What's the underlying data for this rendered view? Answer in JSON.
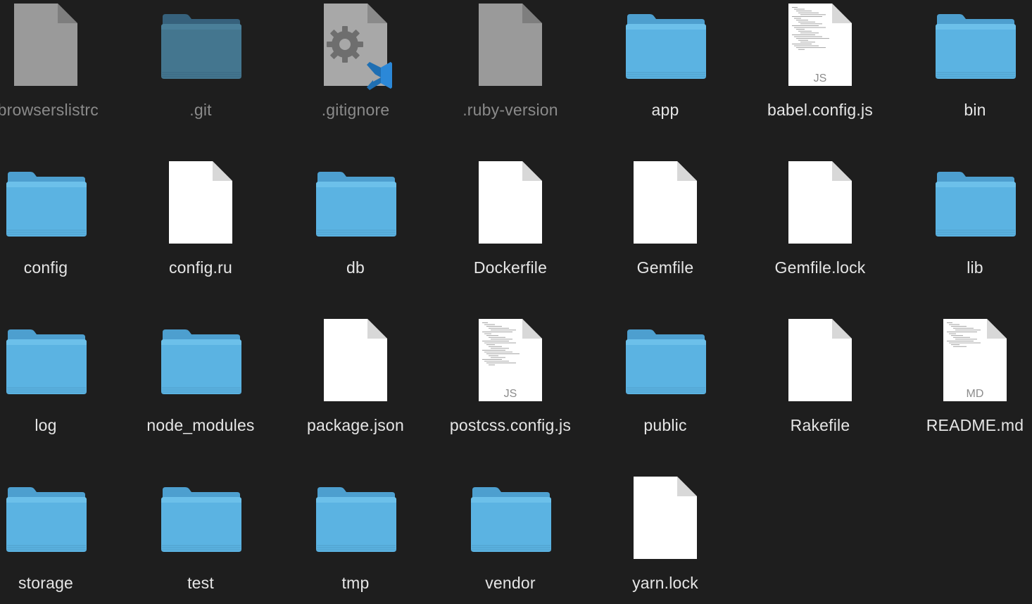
{
  "window": {
    "title": ""
  },
  "items": [
    {
      "name": ".browserslistrc",
      "kind": "doc-gray"
    },
    {
      "name": ".git",
      "kind": "folder-dim"
    },
    {
      "name": ".gitignore",
      "kind": "gear"
    },
    {
      "name": ".ruby-version",
      "kind": "doc-gray"
    },
    {
      "name": "app",
      "kind": "folder"
    },
    {
      "name": "babel.config.js",
      "kind": "js",
      "badge": "JS"
    },
    {
      "name": "bin",
      "kind": "folder"
    },
    {
      "name": "config",
      "kind": "folder"
    },
    {
      "name": "config.ru",
      "kind": "doc"
    },
    {
      "name": "db",
      "kind": "folder"
    },
    {
      "name": "Dockerfile",
      "kind": "doc"
    },
    {
      "name": "Gemfile",
      "kind": "doc"
    },
    {
      "name": "Gemfile.lock",
      "kind": "doc"
    },
    {
      "name": "lib",
      "kind": "folder"
    },
    {
      "name": "log",
      "kind": "folder"
    },
    {
      "name": "node_modules",
      "kind": "folder"
    },
    {
      "name": "package.json",
      "kind": "doc"
    },
    {
      "name": "postcss.config.js",
      "kind": "js",
      "badge": "JS"
    },
    {
      "name": "public",
      "kind": "folder"
    },
    {
      "name": "Rakefile",
      "kind": "doc"
    },
    {
      "name": "README.md",
      "kind": "md",
      "badge": "MD"
    },
    {
      "name": "storage",
      "kind": "folder"
    },
    {
      "name": "test",
      "kind": "folder"
    },
    {
      "name": "tmp",
      "kind": "folder"
    },
    {
      "name": "vendor",
      "kind": "folder"
    },
    {
      "name": "yarn.lock",
      "kind": "doc"
    }
  ],
  "colors": {
    "background": "#1e1e1e",
    "folder": "#5aaedc",
    "folder_dim": "#3f6f8c",
    "label": "#e6e6e6",
    "hidden_label": "#8a8a8a"
  }
}
